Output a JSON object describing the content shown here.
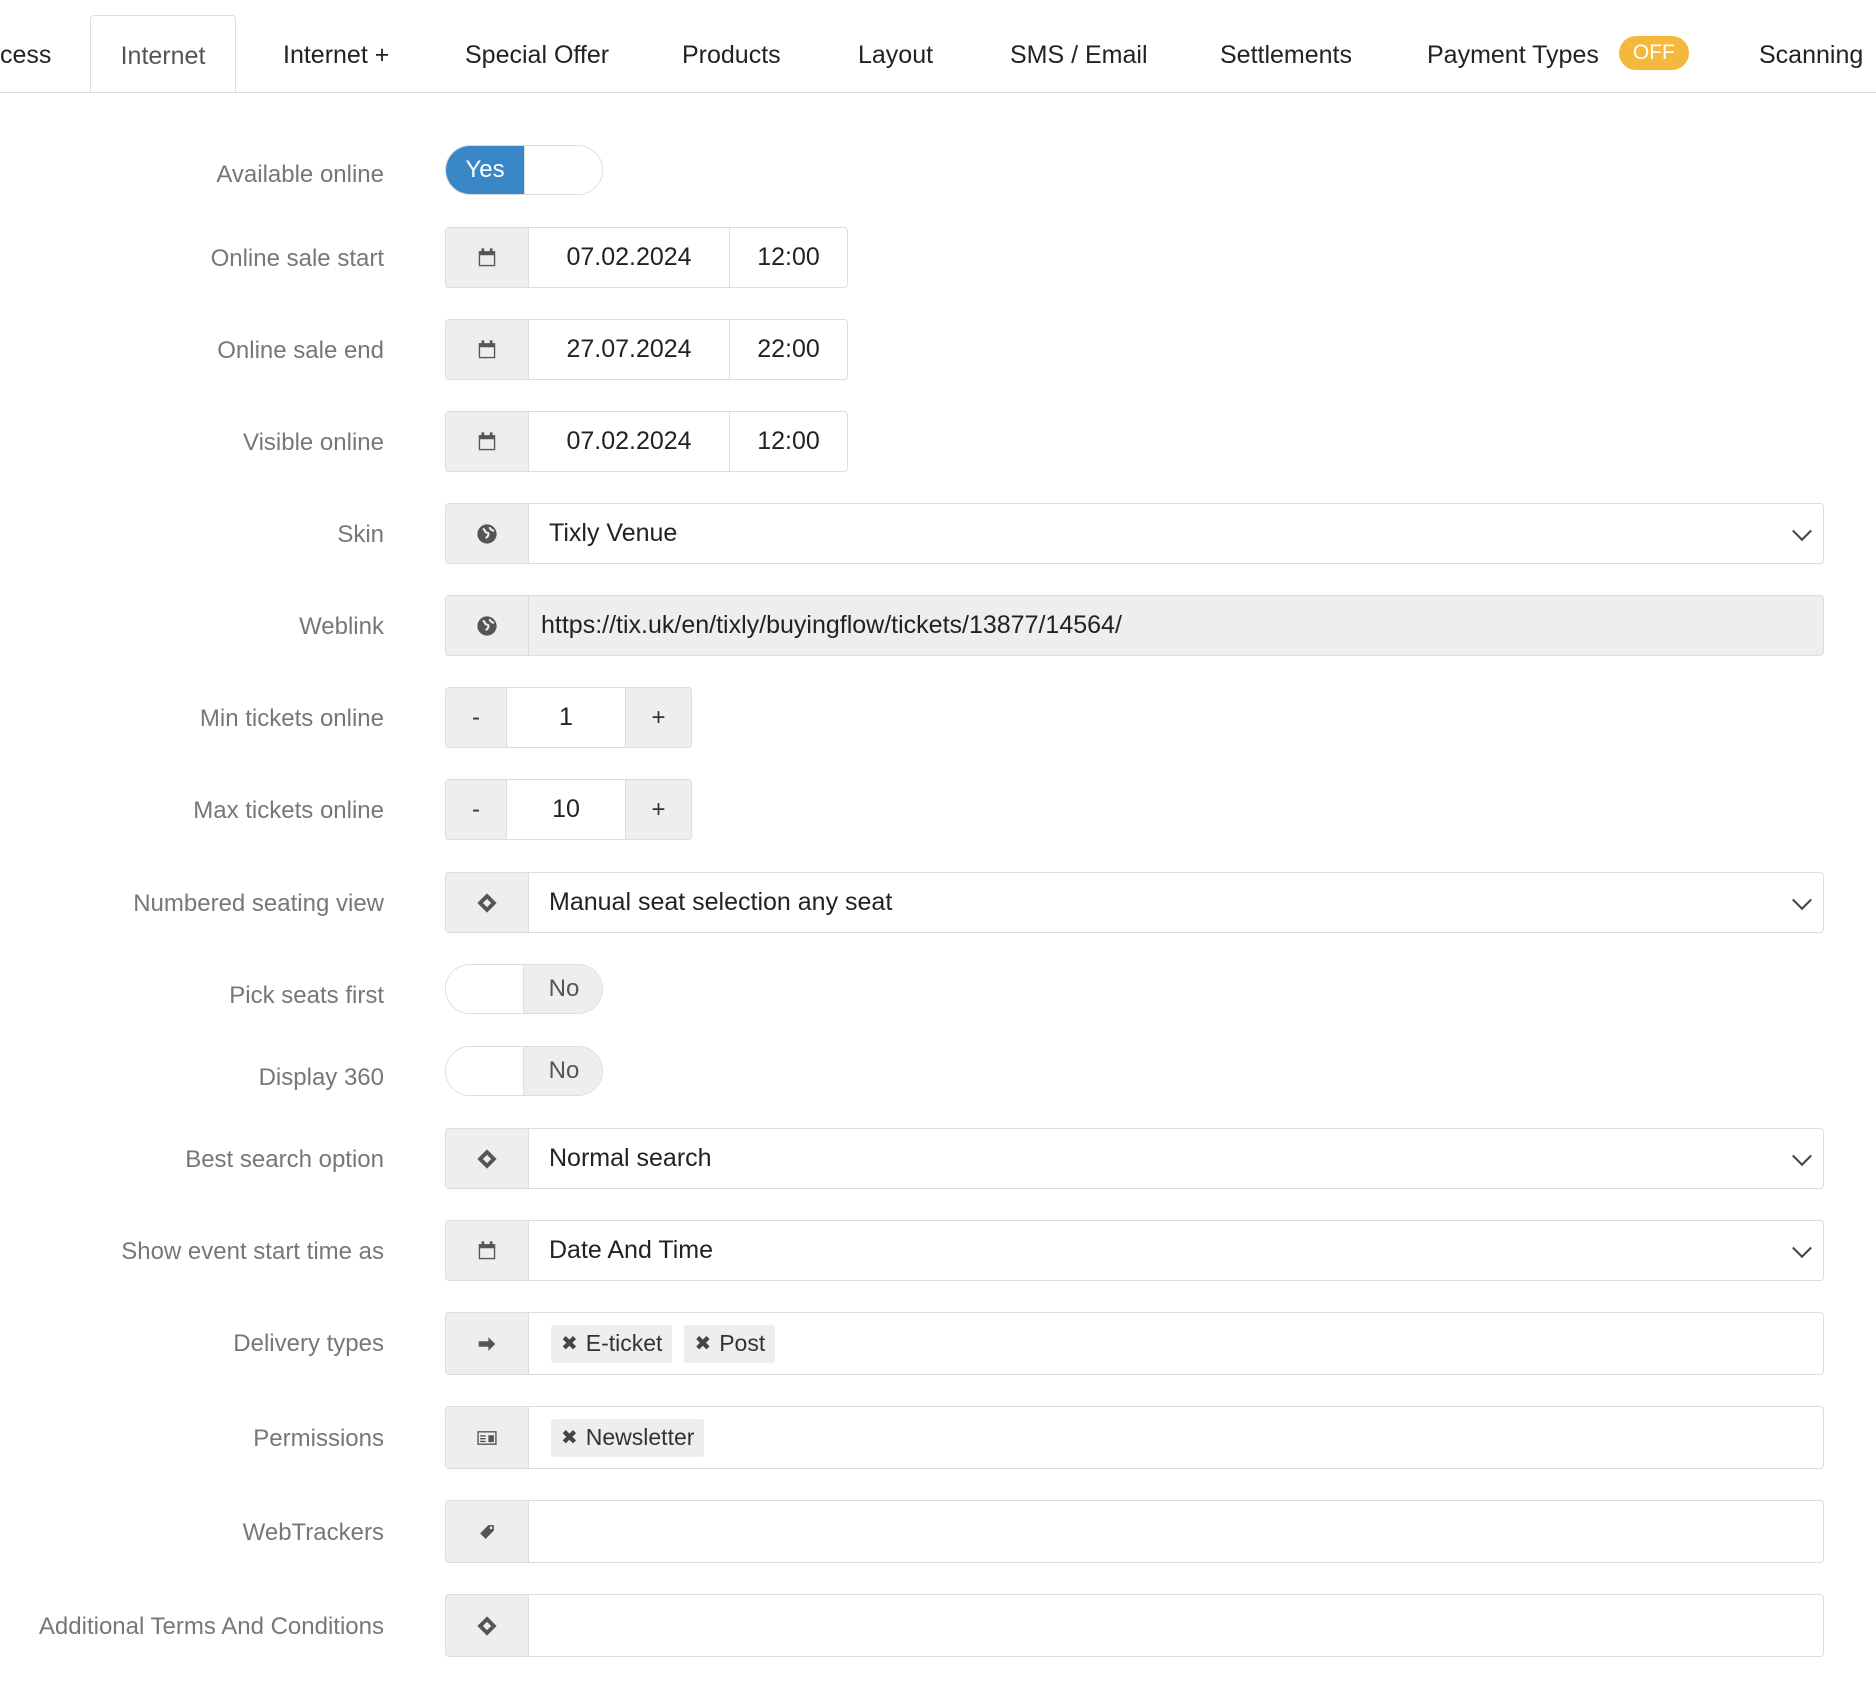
{
  "tabs": [
    {
      "label": "cess"
    },
    {
      "label": "Internet",
      "active": true
    },
    {
      "label": "Internet +"
    },
    {
      "label": "Special Offer"
    },
    {
      "label": "Products"
    },
    {
      "label": "Layout"
    },
    {
      "label": "SMS / Email"
    },
    {
      "label": "Settlements"
    },
    {
      "label": "Payment Types",
      "badge": "OFF"
    },
    {
      "label": "Scanning"
    }
  ],
  "form": {
    "available_online": {
      "label": "Available online",
      "value": "Yes",
      "on": true
    },
    "online_sale_start": {
      "label": "Online sale start",
      "date": "07.02.2024",
      "time": "12:00",
      "icon": "calendar-icon"
    },
    "online_sale_end": {
      "label": "Online sale end",
      "date": "27.07.2024",
      "time": "22:00",
      "icon": "calendar-icon"
    },
    "visible_online": {
      "label": "Visible online",
      "date": "07.02.2024",
      "time": "12:00",
      "icon": "calendar-icon"
    },
    "skin": {
      "label": "Skin",
      "value": "Tixly Venue",
      "icon": "globe-icon"
    },
    "weblink": {
      "label": "Weblink",
      "value": "https://tix.uk/en/tixly/buyingflow/tickets/13877/14564/",
      "icon": "globe-icon"
    },
    "min_tickets": {
      "label": "Min tickets online",
      "value": "1",
      "minus": "-",
      "plus": "+"
    },
    "max_tickets": {
      "label": "Max tickets online",
      "value": "10",
      "minus": "-",
      "plus": "+"
    },
    "numbered_seating": {
      "label": "Numbered seating view",
      "value": "Manual seat selection any seat",
      "icon": "ticket-icon"
    },
    "pick_seats_first": {
      "label": "Pick seats first",
      "value": "No",
      "on": false
    },
    "display_360": {
      "label": "Display 360",
      "value": "No",
      "on": false
    },
    "best_search": {
      "label": "Best search option",
      "value": "Normal search",
      "icon": "ticket-icon"
    },
    "show_event_start": {
      "label": "Show event start time as",
      "value": "Date And Time",
      "icon": "calendar-icon"
    },
    "delivery_types": {
      "label": "Delivery types",
      "tags": [
        "E-ticket",
        "Post"
      ],
      "icon": "arrow-right-icon"
    },
    "permissions": {
      "label": "Permissions",
      "tags": [
        "Newsletter"
      ],
      "icon": "id-card-icon"
    },
    "webtrackers": {
      "label": "WebTrackers",
      "icon": "tag-icon"
    },
    "additional_terms": {
      "label": "Additional Terms And Conditions",
      "icon": "ticket-icon"
    }
  },
  "tag_remove_glyph": "✖",
  "colors": {
    "toggle_on": "#3a87c8",
    "badge": "#f5b83d",
    "addon_bg": "#eeeeee",
    "border": "#dddddd",
    "label": "#777777"
  }
}
